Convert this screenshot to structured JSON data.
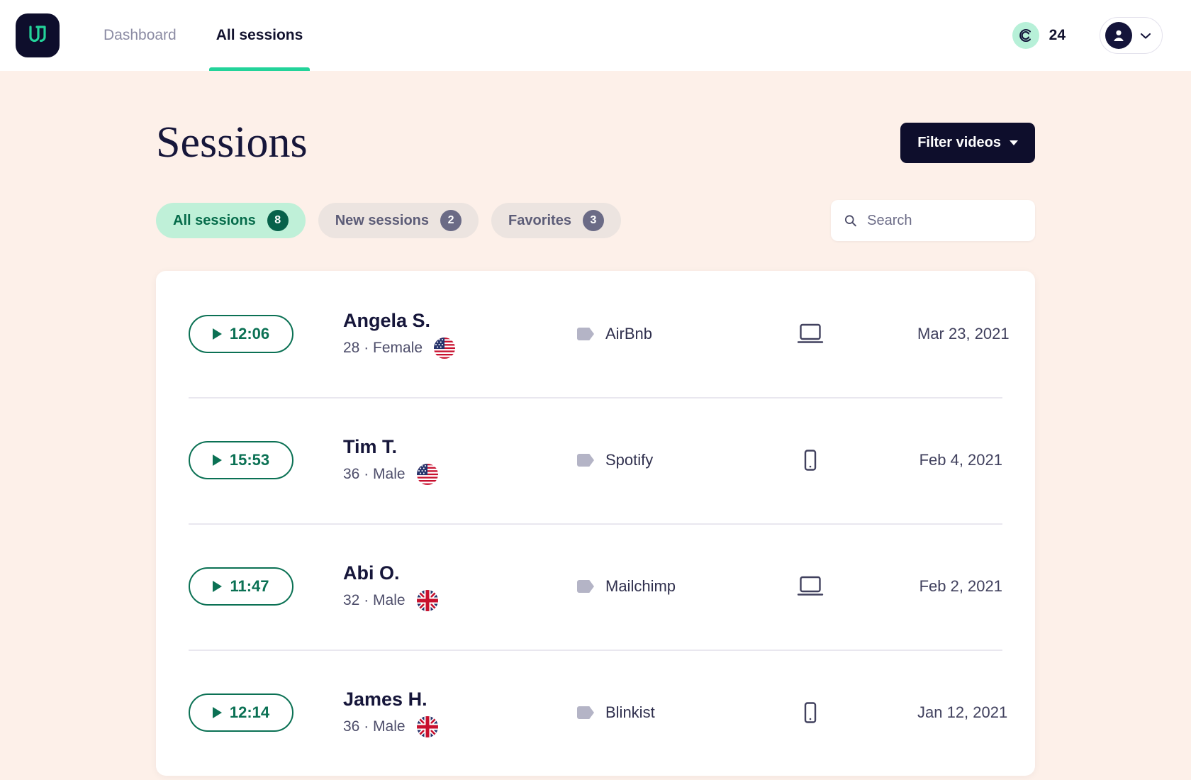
{
  "nav": {
    "logo_icon": "unhurd-u-logo",
    "links": [
      {
        "label": "Dashboard",
        "active": false
      },
      {
        "label": "All sessions",
        "active": true
      }
    ],
    "credits": {
      "icon": "credit-c-icon",
      "count": "24"
    },
    "account": {
      "avatar_icon": "user-avatar-icon",
      "chevron_icon": "chevron-down-icon"
    }
  },
  "header": {
    "title": "Sessions",
    "filter_button": {
      "label": "Filter videos",
      "icon": "caret-down-icon"
    }
  },
  "tabs": [
    {
      "label": "All sessions",
      "count": "8",
      "active": true
    },
    {
      "label": "New sessions",
      "count": "2",
      "active": false
    },
    {
      "label": "Favorites",
      "count": "3",
      "active": false
    }
  ],
  "search": {
    "placeholder": "Search",
    "value": "",
    "icon": "search-icon"
  },
  "sessions": [
    {
      "duration": "12:06",
      "name": "Angela S.",
      "meta": "28 · Female",
      "flag": "us",
      "tag": "AirBnb",
      "device": "laptop",
      "date": "Mar 23, 2021"
    },
    {
      "duration": "15:53",
      "name": "Tim T.",
      "meta": "36 · Male",
      "flag": "us",
      "tag": "Spotify",
      "device": "phone",
      "date": "Feb 4, 2021"
    },
    {
      "duration": "11:47",
      "name": "Abi O.",
      "meta": "32 · Male",
      "flag": "gb",
      "tag": "Mailchimp",
      "device": "laptop",
      "date": "Feb 2, 2021"
    },
    {
      "duration": "12:14",
      "name": "James H.",
      "meta": "36 · Male",
      "flag": "gb",
      "tag": "Blinkist",
      "device": "phone",
      "date": "Jan 12, 2021"
    }
  ],
  "colors": {
    "page_background": "#fdf0e9",
    "brand_dark": "#0e0e2c",
    "brand_mint": "#23d39a",
    "accent_green": "#0b7154",
    "tab_active_bg": "#bff0d8",
    "tab_inactive_bg": "#ece4e0"
  }
}
